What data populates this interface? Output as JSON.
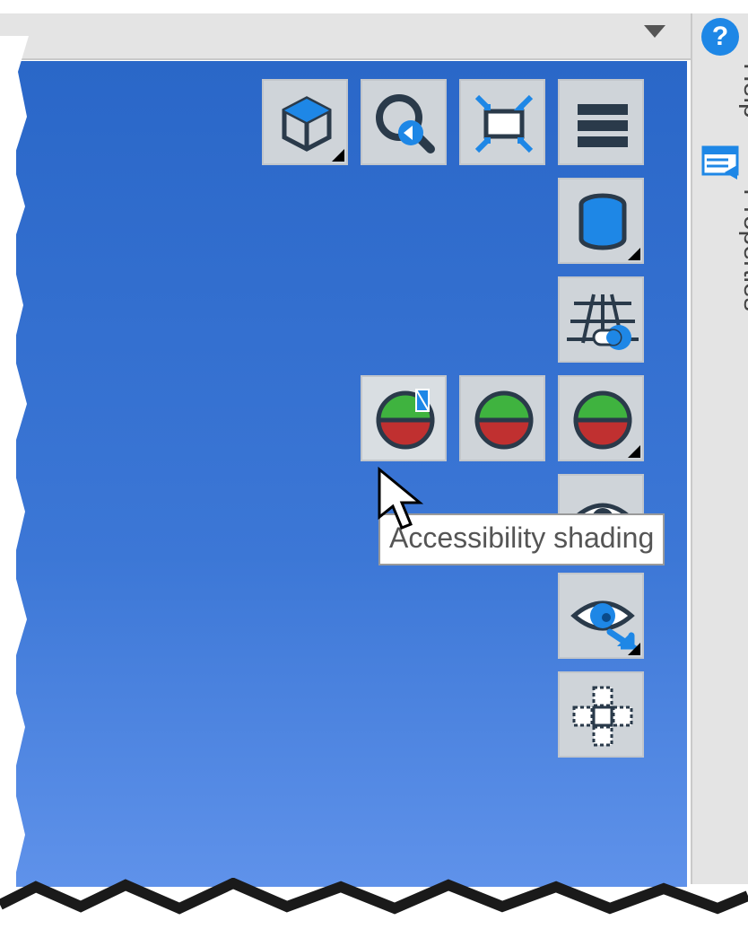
{
  "sidepanel": {
    "help_symbol": "?",
    "help_label": "Help",
    "properties_label": "Properties"
  },
  "tooltip": {
    "text": "Accessibility shading"
  },
  "icons": {
    "cube": "cube-view-icon",
    "zoom": "zoom-previous-icon",
    "fit": "fit-viewport-icon",
    "menu": "menu-icon",
    "cylinder": "cylinder-icon",
    "grid": "grid-toggle-icon",
    "shading1": "accessibility-shading-icon",
    "shading2": "shading-option-icon",
    "shading3": "shading-mode-icon",
    "eye1": "visibility-icon",
    "eye2": "look-at-icon",
    "cross": "unfold-icon"
  },
  "colors": {
    "accent": "#1e87e6",
    "green": "#3fb33f",
    "red": "#c03030",
    "dark": "#2a3a4a"
  }
}
